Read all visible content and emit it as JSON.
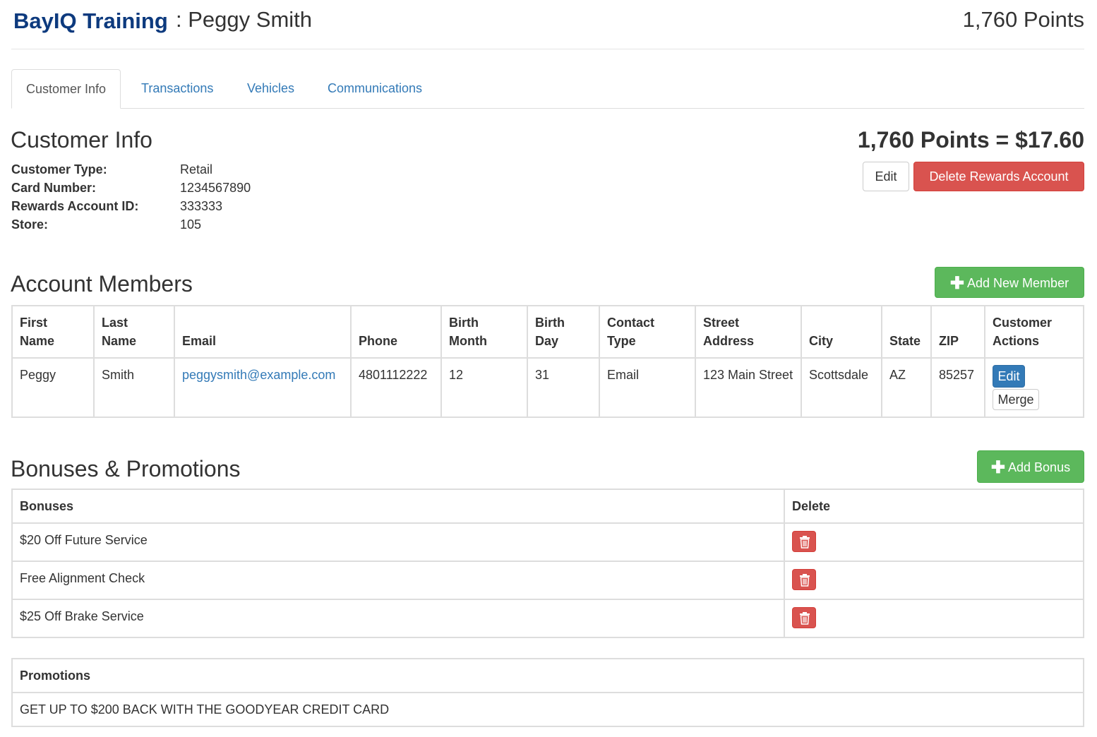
{
  "header": {
    "brand": "BayIQ Training",
    "separator": ":",
    "customer_name": "Peggy Smith",
    "points": "1,760 Points"
  },
  "tabs": [
    {
      "label": "Customer Info",
      "active": true
    },
    {
      "label": "Transactions",
      "active": false
    },
    {
      "label": "Vehicles",
      "active": false
    },
    {
      "label": "Communications",
      "active": false
    }
  ],
  "customer_info": {
    "title": "Customer Info",
    "points_value": "1,760 Points = $17.60",
    "edit_label": "Edit",
    "delete_label": "Delete Rewards Account",
    "fields": [
      {
        "label": "Customer Type:",
        "value": "Retail"
      },
      {
        "label": "Card Number:",
        "value": "1234567890"
      },
      {
        "label": "Rewards Account ID:",
        "value": "333333"
      },
      {
        "label": "Store:",
        "value": "105"
      }
    ]
  },
  "members": {
    "title": "Account Members",
    "add_label": "Add New Member",
    "columns": {
      "first_name": [
        "First",
        "Name"
      ],
      "last_name": [
        "Last",
        "Name"
      ],
      "email": "Email",
      "phone": "Phone",
      "birth_month": [
        "Birth",
        "Month"
      ],
      "birth_day": [
        "Birth",
        "Day"
      ],
      "contact_type": [
        "Contact",
        "Type"
      ],
      "street": [
        "Street",
        "Address"
      ],
      "city": "City",
      "state": "State",
      "zip": "ZIP",
      "actions": [
        "Customer",
        "Actions"
      ]
    },
    "rows": [
      {
        "first_name": "Peggy",
        "last_name": "Smith",
        "email": "peggysmith@example.com",
        "phone": "4801112222",
        "birth_month": "12",
        "birth_day": "31",
        "contact_type": "Email",
        "street": "123 Main Street",
        "city": "Scottsdale",
        "state": "AZ",
        "zip": "85257",
        "edit_label": "Edit",
        "merge_label": "Merge"
      }
    ]
  },
  "bonuses": {
    "title": "Bonuses & Promotions",
    "add_label": "Add Bonus",
    "col_bonuses": "Bonuses",
    "col_delete": "Delete",
    "items": [
      "$20 Off Future Service",
      "Free Alignment Check",
      "$25 Off Brake Service"
    ]
  },
  "promotions": {
    "col_label": "Promotions",
    "items": [
      "GET UP TO $200 BACK WITH THE GOODYEAR CREDIT CARD"
    ]
  },
  "icons": {
    "plus": "plus-icon",
    "trash": "trash-icon"
  },
  "colors": {
    "brand": "#0d3a7e",
    "link": "#337ab7",
    "danger": "#d9534f",
    "success": "#5cb85c",
    "primary": "#337ab7"
  }
}
